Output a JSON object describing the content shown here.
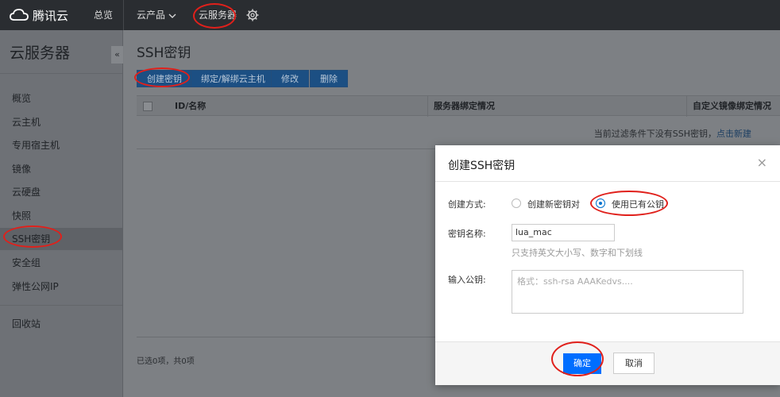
{
  "topbar": {
    "logo_text": "腾讯云",
    "nav": [
      {
        "label": "总览"
      },
      {
        "label": "云产品"
      },
      {
        "label": "云服务器"
      }
    ],
    "settings_icon": "gear-icon"
  },
  "sidebar": {
    "title": "云服务器",
    "collapse_glyph": "«",
    "items": [
      {
        "label": "概览"
      },
      {
        "label": "云主机"
      },
      {
        "label": "专用宿主机"
      },
      {
        "label": "镜像"
      },
      {
        "label": "云硬盘"
      },
      {
        "label": "快照"
      },
      {
        "label": "SSH密钥"
      },
      {
        "label": "安全组"
      },
      {
        "label": "弹性公网IP"
      },
      {
        "label": "回收站"
      }
    ],
    "active_item": "SSH密钥"
  },
  "main": {
    "title": "SSH密钥",
    "toolbar": {
      "create": "创建密钥",
      "bind": "绑定/解绑云主机",
      "edit": "修改",
      "delete": "删除"
    },
    "table": {
      "columns": [
        "ID/名称",
        "服务器绑定情况",
        "自定义镜像绑定情况"
      ],
      "empty_text": "当前过滤条件下没有SSH密钥，",
      "empty_link": "点击新建"
    },
    "footer_count": "已选0项，共0项"
  },
  "dialog": {
    "title": "创建SSH密钥",
    "close_glyph": "×",
    "method_label": "创建方式:",
    "method_options": [
      {
        "label": "创建新密钥对",
        "checked": false
      },
      {
        "label": "使用已有公钥",
        "checked": true
      }
    ],
    "name_label": "密钥名称:",
    "name_value": "lua_mac",
    "name_hint": "只支持英文大小写、数字和下划线",
    "pubkey_label": "输入公钥:",
    "pubkey_placeholder": "格式：ssh-rsa AAAKedvs....",
    "confirm": "确定",
    "cancel": "取消"
  },
  "colors": {
    "annotation_red": "#e0201b",
    "primary_blue": "#006eff"
  }
}
